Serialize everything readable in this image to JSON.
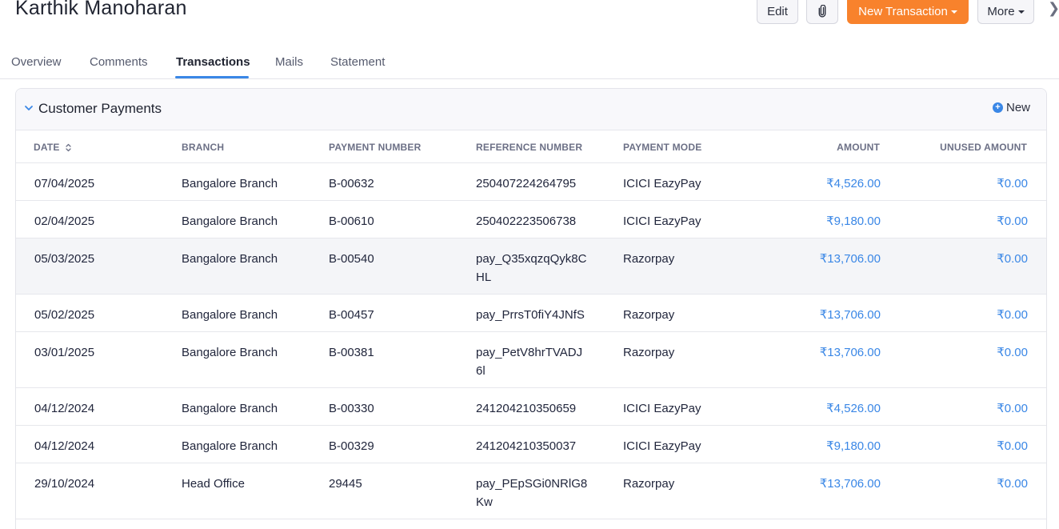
{
  "header": {
    "contact_name": "Karthik Manoharan",
    "edit_label": "Edit",
    "new_transaction_label": "New Transaction",
    "more_label": "More"
  },
  "tabs": [
    {
      "label": "Overview",
      "active": false
    },
    {
      "label": "Comments",
      "active": false
    },
    {
      "label": "Transactions",
      "active": true
    },
    {
      "label": "Mails",
      "active": false
    },
    {
      "label": "Statement",
      "active": false
    }
  ],
  "payments": {
    "title": "Customer Payments",
    "new_label": "New",
    "columns": {
      "date": "DATE",
      "branch": "BRANCH",
      "payment_number": "PAYMENT NUMBER",
      "reference_number": "REFERENCE NUMBER",
      "payment_mode": "PAYMENT MODE",
      "amount": "AMOUNT",
      "unused_amount": "UNUSED AMOUNT"
    },
    "rows": [
      {
        "date": "07/04/2025",
        "branch": "Bangalore Branch",
        "payment_number": "B-00632",
        "reference_number": "250407224264795",
        "payment_mode": "ICICI EazyPay",
        "amount": "₹4,526.00",
        "unused_amount": "₹0.00"
      },
      {
        "date": "02/04/2025",
        "branch": "Bangalore Branch",
        "payment_number": "B-00610",
        "reference_number": "250402223506738",
        "payment_mode": "ICICI EazyPay",
        "amount": "₹9,180.00",
        "unused_amount": "₹0.00"
      },
      {
        "date": "05/03/2025",
        "branch": "Bangalore Branch",
        "payment_number": "B-00540",
        "reference_number": "pay_Q35xqzqQyk8CHL",
        "payment_mode": "Razorpay",
        "amount": "₹13,706.00",
        "unused_amount": "₹0.00"
      },
      {
        "date": "05/02/2025",
        "branch": "Bangalore Branch",
        "payment_number": "B-00457",
        "reference_number": "pay_PrrsT0fiY4JNfS",
        "payment_mode": "Razorpay",
        "amount": "₹13,706.00",
        "unused_amount": "₹0.00"
      },
      {
        "date": "03/01/2025",
        "branch": "Bangalore Branch",
        "payment_number": "B-00381",
        "reference_number": "pay_PetV8hrTVADJ6l",
        "payment_mode": "Razorpay",
        "amount": "₹13,706.00",
        "unused_amount": "₹0.00"
      },
      {
        "date": "04/12/2024",
        "branch": "Bangalore Branch",
        "payment_number": "B-00330",
        "reference_number": "241204210350659",
        "payment_mode": "ICICI EazyPay",
        "amount": "₹4,526.00",
        "unused_amount": "₹0.00"
      },
      {
        "date": "04/12/2024",
        "branch": "Bangalore Branch",
        "payment_number": "B-00329",
        "reference_number": "241204210350037",
        "payment_mode": "ICICI EazyPay",
        "amount": "₹9,180.00",
        "unused_amount": "₹0.00"
      },
      {
        "date": "29/10/2024",
        "branch": "Head Office",
        "payment_number": "29445",
        "reference_number": "pay_PEpSGi0NRlG8Kw",
        "payment_mode": "Razorpay",
        "amount": "₹13,706.00",
        "unused_amount": "₹0.00"
      }
    ]
  },
  "colors": {
    "accent": "#3a87e6",
    "primary_button": "#f8822c"
  }
}
